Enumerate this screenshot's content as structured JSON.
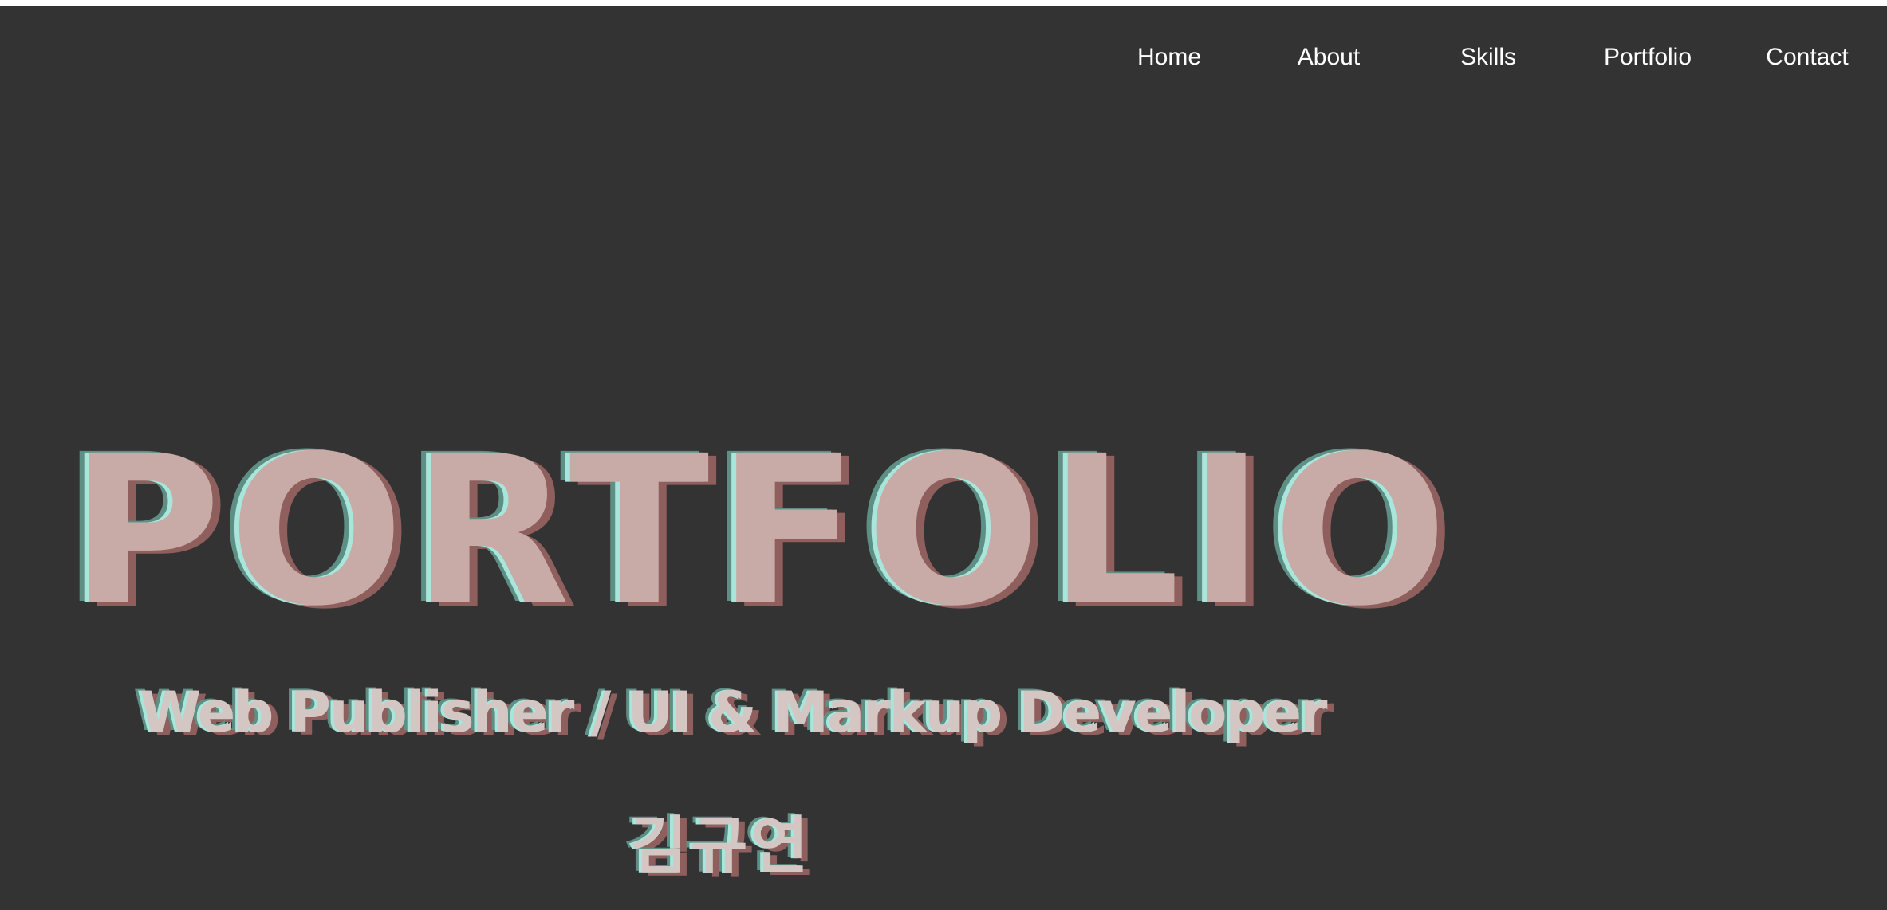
{
  "nav": {
    "items": [
      {
        "label": "Home"
      },
      {
        "label": "About"
      },
      {
        "label": "Skills"
      },
      {
        "label": "Portfolio"
      },
      {
        "label": "Contact"
      }
    ]
  },
  "hero": {
    "title": "PORTFOLIO",
    "subtitle": "Web Publisher / UI & Markup Developer",
    "name": "김규연"
  },
  "colors": {
    "background": "#333333",
    "nav_text": "#ffffff",
    "text_main": "#c8aaa6",
    "shadow_mint": "#a8e6dc",
    "shadow_teal": "#5e8f84",
    "shadow_red": "#8e5f5c"
  }
}
